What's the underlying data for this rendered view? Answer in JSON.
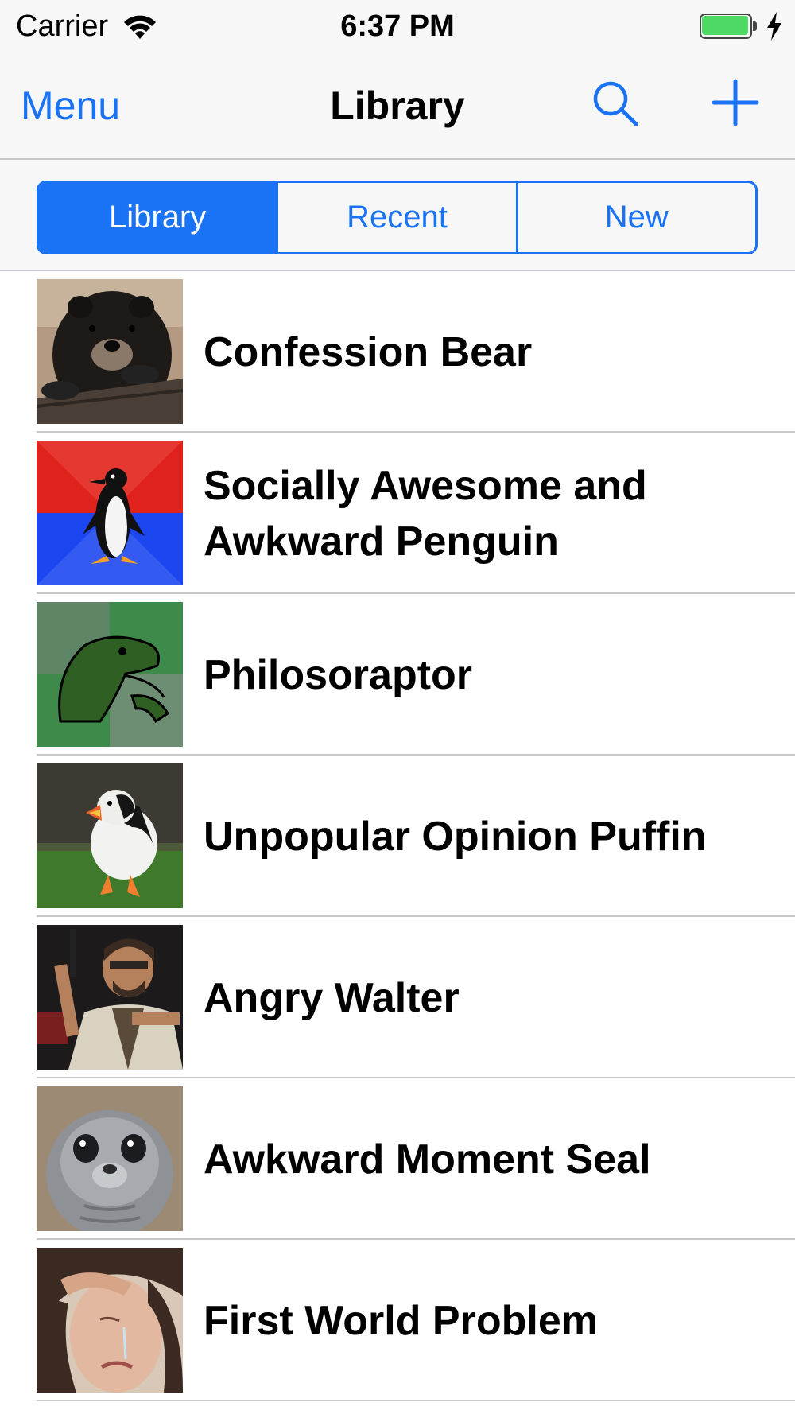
{
  "colors": {
    "accent": "#1a73f5",
    "battery": "#4cd964",
    "separator": "#c8c7cc",
    "bar_background": "#f7f7f7"
  },
  "status_bar": {
    "carrier": "Carrier",
    "time": "6:37 PM",
    "wifi_icon": "wifi-icon",
    "battery_icon": "battery-icon",
    "charging_icon": "lightning-bolt-icon"
  },
  "nav": {
    "menu_label": "Menu",
    "title": "Library",
    "search_icon": "search-icon",
    "add_icon": "plus-icon"
  },
  "segments": [
    {
      "label": "Library",
      "selected": true
    },
    {
      "label": "Recent",
      "selected": false
    },
    {
      "label": "New",
      "selected": false
    }
  ],
  "list": {
    "items": [
      {
        "title": "Confession Bear",
        "thumbnail": "bear-photo"
      },
      {
        "title": "Socially Awesome and Awkward Penguin",
        "thumbnail": "penguin-image"
      },
      {
        "title": "Philosoraptor",
        "thumbnail": "raptor-image"
      },
      {
        "title": "Unpopular Opinion Puffin",
        "thumbnail": "puffin-photo"
      },
      {
        "title": "Angry Walter",
        "thumbnail": "walter-photo"
      },
      {
        "title": "Awkward Moment Seal",
        "thumbnail": "seal-photo"
      },
      {
        "title": "First World Problem",
        "thumbnail": "crying-woman-photo"
      }
    ]
  }
}
